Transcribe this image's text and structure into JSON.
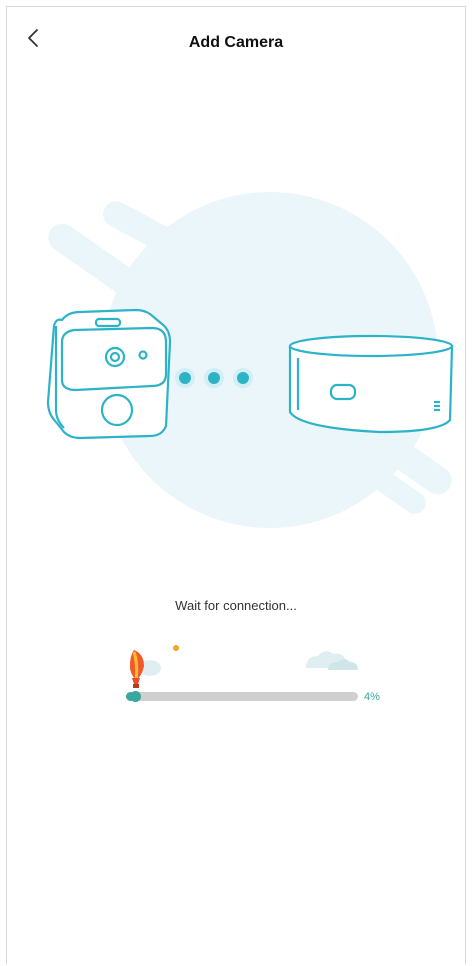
{
  "header": {
    "title": "Add Camera"
  },
  "status": {
    "message": "Wait for connection..."
  },
  "progress": {
    "value": 0.04,
    "label": "4%"
  },
  "colors": {
    "accent": "#2db3c8",
    "progress": "#3aa6a0",
    "bubble": "#eaf6fa"
  },
  "icons": {
    "back": "chevron-left-icon",
    "camera": "camera-icon",
    "hub": "base-station-icon",
    "balloon": "hot-air-balloon-icon",
    "cloud": "cloud-icon"
  }
}
